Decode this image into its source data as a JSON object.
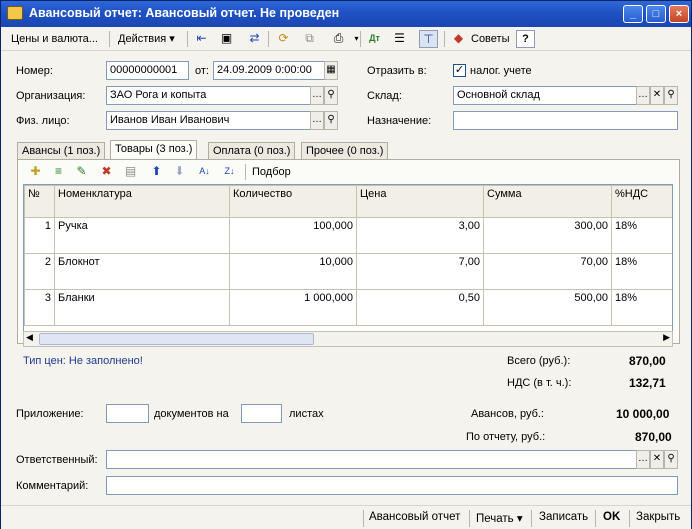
{
  "window": {
    "title": "Авансовый отчет: Авансовый отчет. Не проведен",
    "minimize": "_",
    "maximize": "□",
    "close": "×"
  },
  "toolbar": {
    "prices_menu": "Цены и валюта...",
    "actions_menu": "Действия",
    "tips_button": "Советы",
    "help_button": "?",
    "icons": [
      "back-arrow-icon",
      "document-view-icon",
      "go-to-icon",
      "refresh-icon",
      "copy-icon",
      "print-icon",
      "dt-kt-icon",
      "journal-icon",
      "structure-icon"
    ]
  },
  "header": {
    "number_label": "Номер:",
    "number_value": "00000000001",
    "date_label": "от:",
    "date_value": "24.09.2009  0:00:00",
    "reflect_label": "Отразить в:",
    "tax_label": "налог. учете",
    "tax_checked": true,
    "org_label": "Организация:",
    "org_value": "ЗАО Рога и копыта",
    "warehouse_label": "Склад:",
    "warehouse_value": "Основной склад",
    "person_label": "Физ. лицо:",
    "person_value": "Иванов Иван Иванович",
    "purpose_label": "Назначение:",
    "purpose_value": ""
  },
  "tabs": [
    {
      "label": "Авансы (1 поз.)",
      "active": false
    },
    {
      "label": "Товары (3 поз.)",
      "active": true
    },
    {
      "label": "Оплата (0 поз.)",
      "active": false
    },
    {
      "label": "Прочее (0 поз.)",
      "active": false
    }
  ],
  "table_toolbar": {
    "selection_label": "Подбор"
  },
  "table": {
    "columns": [
      "№",
      "Номенклатура",
      "Количество",
      "Цена",
      "Сумма",
      "%НДС"
    ],
    "rows": [
      {
        "n": "1",
        "name": "Ручка",
        "qty": "100,000",
        "price": "3,00",
        "sum": "300,00",
        "vat": "18%"
      },
      {
        "n": "2",
        "name": "Блокнот",
        "qty": "10,000",
        "price": "7,00",
        "sum": "70,00",
        "vat": "18%"
      },
      {
        "n": "3",
        "name": "Бланки",
        "qty": "1 000,000",
        "price": "0,50",
        "sum": "500,00",
        "vat": "18%"
      }
    ]
  },
  "summary": {
    "price_type": "Тип цен: Не заполнено!",
    "total_label": "Всего (руб.):",
    "total_value": "870,00",
    "vat_label": "НДС (в т. ч.):",
    "vat_value": "132,71",
    "attach_label": "Приложение:",
    "docs_label": "документов на",
    "sheets_label": "листах",
    "attach_docs_value": "",
    "attach_sheets_value": "",
    "advances_label": "Авансов, руб.:",
    "advances_value": "10 000,00",
    "report_label": "По отчету, руб.:",
    "report_value": "870,00",
    "responsible_label": "Ответственный:",
    "responsible_value": "",
    "comment_label": "Комментарий:",
    "comment_value": ""
  },
  "bottom": {
    "report_button": "Авансовый отчет",
    "print_button": "Печать",
    "save_button": "Записать",
    "ok_button": "OK",
    "close_button": "Закрыть"
  }
}
